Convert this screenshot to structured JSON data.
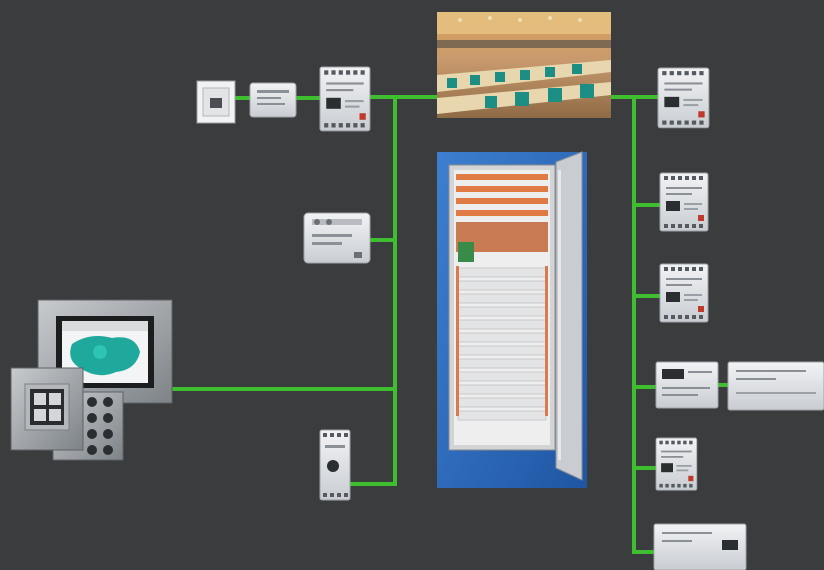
{
  "colors": {
    "background": "#3a3c3e",
    "bus_line": "#3fbf2f",
    "device_housing": "#dcdfe3",
    "cabinet_backdrop": "#2f6fc0",
    "touch_display_green": "#1fa89c"
  },
  "devices": {
    "wall_outlet": {
      "icon": "wall-socket-icon"
    },
    "power_adapter": {
      "icon": "power-supply-icon"
    },
    "din_module_top": {
      "icon": "din-rail-module-icon"
    },
    "conference_room_photo": {
      "icon": "conference-room-image"
    },
    "wall_mount_controller": {
      "icon": "wall-controller-icon"
    },
    "control_cabinet": {
      "icon": "electrical-cabinet-icon"
    },
    "touch_panel": {
      "icon": "touch-panel-icon"
    },
    "keypad_4_button": {
      "icon": "push-button-panel-icon"
    },
    "keypad_numeric": {
      "icon": "numeric-keypad-icon"
    },
    "bus_interface": {
      "icon": "bus-interface-icon"
    },
    "right_module_1": {
      "icon": "din-rail-module-icon"
    },
    "right_module_2": {
      "icon": "din-rail-module-icon"
    },
    "right_module_3": {
      "icon": "din-rail-module-icon"
    },
    "right_module_wide": {
      "icon": "din-rail-module-icon"
    },
    "right_module_extension": {
      "icon": "din-rail-module-icon"
    },
    "right_module_5": {
      "icon": "din-rail-module-icon"
    },
    "right_module_bottom": {
      "icon": "din-rail-module-icon"
    }
  }
}
